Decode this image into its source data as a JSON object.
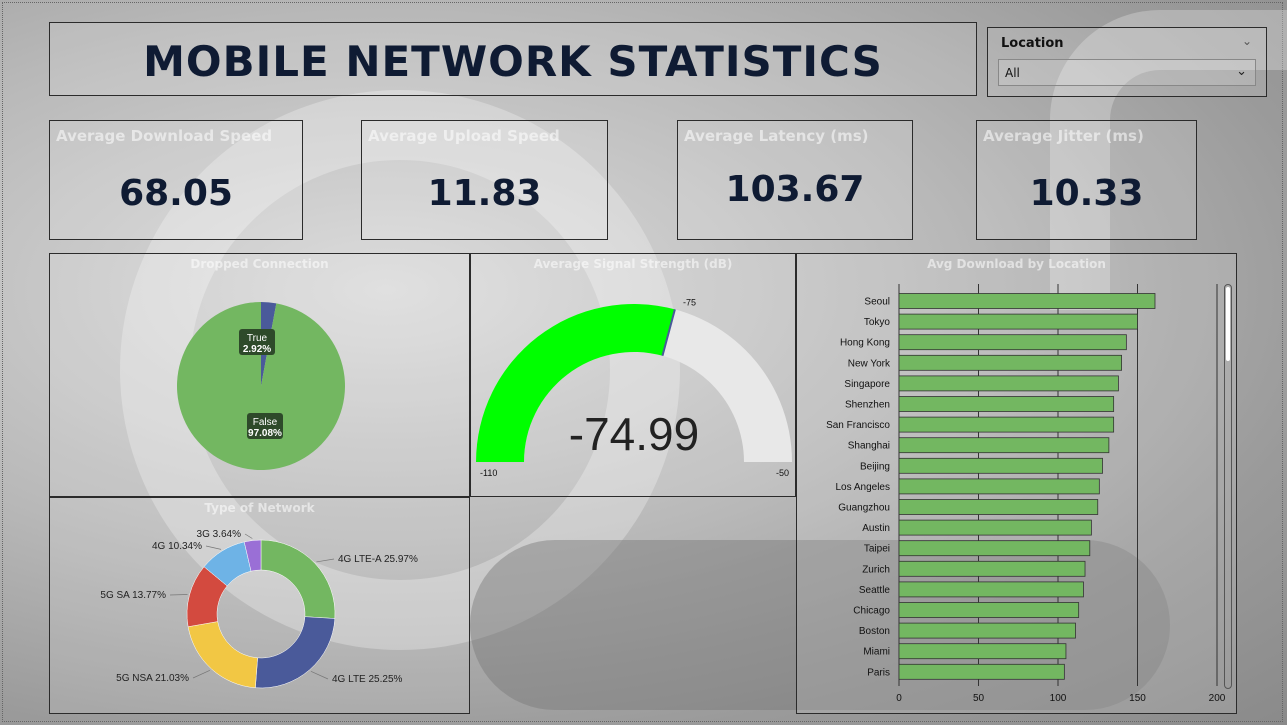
{
  "header": {
    "title": "MOBILE NETWORK STATISTICS"
  },
  "slicer": {
    "label": "Location",
    "value": "All"
  },
  "cards": [
    {
      "title": "Average Download Speed",
      "value": "68.05"
    },
    {
      "title": "Average Upload Speed",
      "value": "11.83"
    },
    {
      "title": "Average Latency (ms)",
      "value": "103.67"
    },
    {
      "title": "Average Jitter (ms)",
      "value": "10.33"
    }
  ],
  "colors": {
    "bar": "#73b761",
    "gauge_fill": "#00ff00",
    "gauge_bg": "#e8e8e8",
    "title": "#0f1b33"
  },
  "chart_data": [
    {
      "type": "pie",
      "title": "Dropped Connection",
      "slices": [
        {
          "label": "True",
          "value": 2.92,
          "display": "2.92%",
          "color": "#4a5a9a"
        },
        {
          "label": "False",
          "value": 97.08,
          "display": "97.08%",
          "color": "#73b761"
        }
      ]
    },
    {
      "type": "gauge",
      "title": "Average Signal Strength (dB)",
      "value": -74.99,
      "display": "-74.99",
      "min": -110,
      "max": -50,
      "target": -75,
      "min_label": "-110",
      "max_label": "-50",
      "target_label": "-75"
    },
    {
      "type": "donut",
      "title": "Type of Network",
      "slices": [
        {
          "label": "4G LTE-A",
          "value": 25.97,
          "display": "4G LTE-A 25.97%",
          "color": "#73b761"
        },
        {
          "label": "4G LTE",
          "value": 25.25,
          "display": "4G LTE 25.25%",
          "color": "#4a5a9a"
        },
        {
          "label": "5G NSA",
          "value": 21.03,
          "display": "5G NSA 21.03%",
          "color": "#f2c744"
        },
        {
          "label": "5G SA",
          "value": 13.77,
          "display": "5G SA 13.77%",
          "color": "#d34a3f"
        },
        {
          "label": "4G",
          "value": 10.34,
          "display": "4G 10.34%",
          "color": "#6eb3e6"
        },
        {
          "label": "3G",
          "value": 3.64,
          "display": "3G 3.64%",
          "color": "#9a6fd6"
        }
      ]
    },
    {
      "type": "bar",
      "orientation": "horizontal",
      "title": "Avg Download by Location",
      "categories": [
        "Seoul",
        "Tokyo",
        "Hong Kong",
        "New York",
        "Singapore",
        "Shenzhen",
        "San Francisco",
        "Shanghai",
        "Beijing",
        "Los Angeles",
        "Guangzhou",
        "Austin",
        "Taipei",
        "Zurich",
        "Seattle",
        "Chicago",
        "Boston",
        "Miami",
        "Paris"
      ],
      "values": [
        161,
        150,
        143,
        140,
        138,
        135,
        135,
        132,
        128,
        126,
        125,
        121,
        120,
        117,
        116,
        113,
        111,
        105,
        104
      ],
      "xlim": [
        0,
        200
      ],
      "xticks": [
        "0",
        "50",
        "100",
        "150",
        "200"
      ],
      "grid": true
    }
  ]
}
